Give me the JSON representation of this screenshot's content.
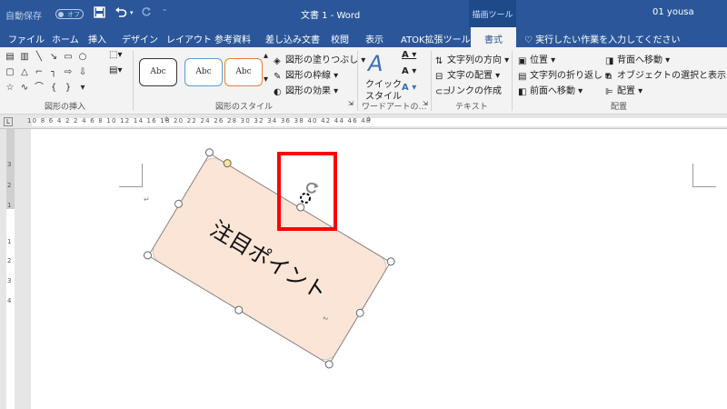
{
  "titlebar": {
    "autosave": "自動保存",
    "toggle": "オフ",
    "doc_title": "文書 1 - Word",
    "context_tab": "描画ツール",
    "user": "01 yousa"
  },
  "tabs": [
    "ファイル",
    "ホーム",
    "挿入",
    "デザイン",
    "レイアウト",
    "参考資料",
    "差し込み文書",
    "校閲",
    "表示",
    "ATOK拡張ツール"
  ],
  "active_tab": "書式",
  "tell_me": "実行したい作業を入力してください",
  "ribbon": {
    "groups": {
      "insert_shapes": "図形の挿入",
      "shape_styles": "図形のスタイル",
      "wordart": "ワードアートの…",
      "text": "テキスト",
      "arrange": "配置"
    },
    "style_samples": [
      "Abc",
      "Abc",
      "Abc"
    ],
    "fill": "図形の塗りつぶし",
    "outline": "図形の枠線",
    "effects": "図形の効果",
    "quick_style_1": "クイック",
    "quick_style_2": "スタイル",
    "text_direction": "文字列の方向",
    "text_align": "文字の配置",
    "create_link": "リンクの作成",
    "position": "位置",
    "wrap_text": "文字列の折り返し",
    "bring_forward": "前面へ移動",
    "send_backward": "背面へ移動",
    "selection_pane": "オブジェクトの選択と表示",
    "align": "配置"
  },
  "ruler": {
    "numbers": "10 8 6 4 2   2 4 6 8 10 12 14 16 18 20 22 24 26 28 30 32 34 36 38 40 42 44 46 48",
    "vnums": [
      "3",
      "2",
      "1",
      "1",
      "2",
      "3",
      "4"
    ]
  },
  "shape_text": "注目ポイント",
  "colors": {
    "word_blue": "#2b579a",
    "shape_fill": "#fbe5d6",
    "highlight": "#ff0000",
    "adjust_handle": "#ffe699"
  }
}
